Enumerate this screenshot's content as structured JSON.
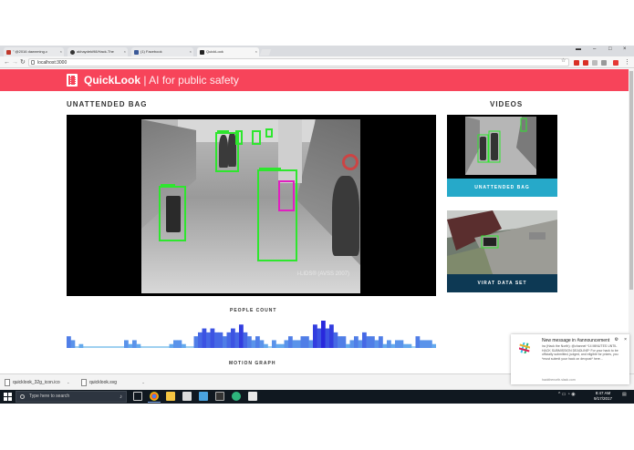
{
  "browser": {
    "tabs": [
      {
        "label": "\" @2016 dawnming.c",
        "favicon_color": "#c0392b",
        "active": false
      },
      {
        "label": "akhaydeki98/Hack-The",
        "favicon_color": "#333333",
        "active": false
      },
      {
        "label": "(1) Facebook",
        "favicon_color": "#3b5998",
        "active": false
      },
      {
        "label": "QuickLook",
        "favicon_color": "#222222",
        "active": true
      }
    ],
    "url": "localhost:3000"
  },
  "app": {
    "brand_name": "QuickLook",
    "brand_tagline": "| AI for public safety",
    "header_color": "#f7445a"
  },
  "main": {
    "section_title": "UNATTENDED BAG",
    "video_watermark": "i-LIDS® (AVSS 2007)"
  },
  "sidebar": {
    "title": "VIDEOS",
    "videos": [
      {
        "label": "UNATTENDED BAG",
        "caption_color": "#26a9c9"
      },
      {
        "label": "VIRAT DATA SET",
        "caption_color": "#0d3954"
      }
    ]
  },
  "people_count": {
    "label": "PEOPLE COUNT",
    "footer_label": "MOTION GRAPH"
  },
  "chart_data": {
    "type": "bar",
    "title": "PEOPLE COUNT",
    "xlabel": "",
    "ylabel": "",
    "series": [
      {
        "values": [
          3,
          2,
          0,
          1,
          0,
          0,
          0,
          0,
          0,
          0,
          0,
          0,
          0,
          0,
          2,
          1,
          2,
          1,
          0,
          0,
          0,
          0,
          0,
          0,
          0,
          1,
          2,
          2,
          1,
          0,
          0,
          3,
          4,
          5,
          4,
          5,
          4,
          4,
          3,
          4,
          5,
          4,
          6,
          4,
          3,
          2,
          3,
          2,
          1,
          0,
          2,
          1,
          1,
          2,
          3,
          2,
          2,
          3,
          3,
          2,
          6,
          5,
          7,
          5,
          6,
          4,
          3,
          3,
          1,
          2,
          3,
          2,
          4,
          3,
          3,
          2,
          3,
          1,
          2,
          1,
          2,
          2,
          1,
          1,
          0,
          3,
          2,
          2,
          2,
          1
        ]
      }
    ]
  },
  "downloads": {
    "items": [
      {
        "label": "quicklook_32g_icon.ico"
      },
      {
        "label": "quicklook.svg"
      }
    ]
  },
  "notification": {
    "title": "New message in #announcement",
    "body": "ira (Hack the North): @channel *14 MINUTES UNTIL HACK SUBMISSION DEADLINE* For your hack to be officially submitted, judged, and eligible for prizes, you *must submit your hack on devpost* here...",
    "source": "hackthenorth.slack.com"
  },
  "taskbar": {
    "search_placeholder": "Type here to search",
    "time": "8:47 AM",
    "date": "9/17/2017"
  }
}
